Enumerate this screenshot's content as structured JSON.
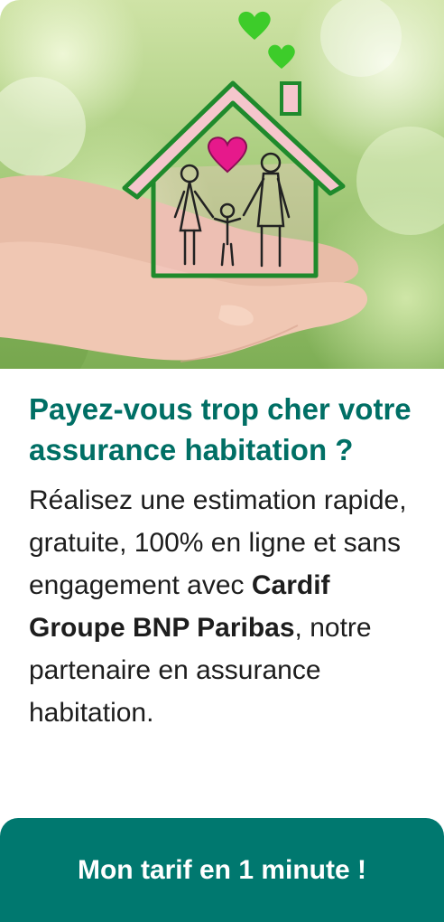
{
  "hero": {
    "image": "hands-holding-house-with-family-illustration",
    "colors": {
      "house_line": "#1f8a2c",
      "roof_fill": "#f5c6cc",
      "heart_pink": "#e6198b",
      "heart_green": "#3dcc2a"
    }
  },
  "promo": {
    "headline": "Payez-vous trop cher votre assurance habitation ?",
    "body_intro": "Réalisez une estimation rapide, gratuite, 100% en ligne et sans engagement avec ",
    "partner_name": "Cardif Groupe BNP Paribas",
    "body_outro": ", notre partenaire en assurance habitation."
  },
  "cta": {
    "label": "Mon tarif en 1 minute !"
  },
  "colors": {
    "headline": "#006f65",
    "button": "#00786f",
    "body_text": "#1d1d1d"
  }
}
